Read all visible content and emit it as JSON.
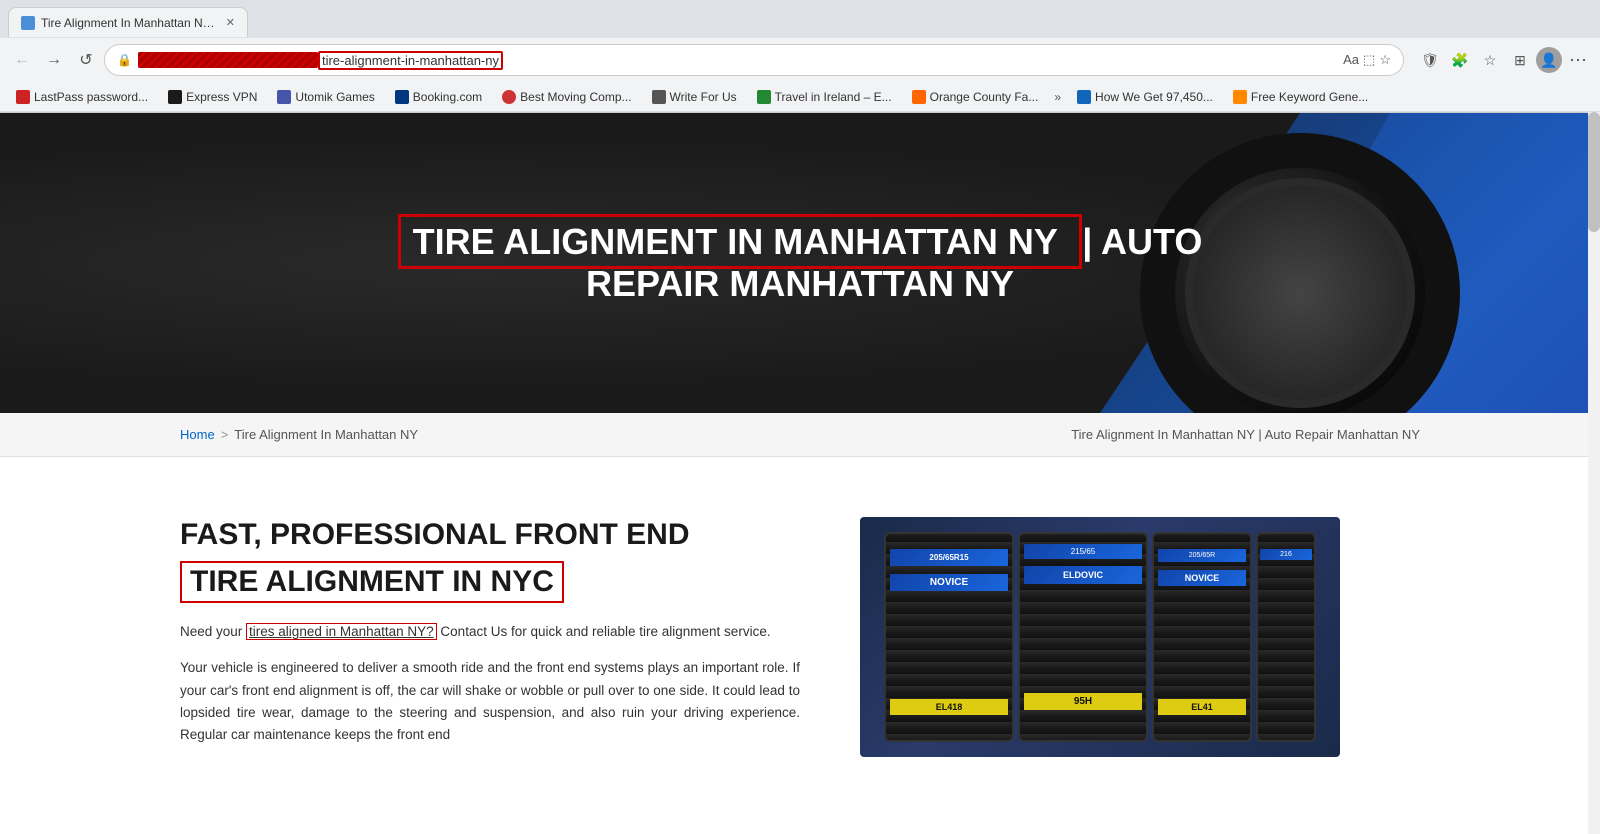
{
  "browser": {
    "tab": {
      "title": "Tire Alignment In Manhattan NY | Auto Repair Manhattan NY"
    },
    "address_bar": {
      "redacted_part": "https://[redacted]",
      "visible_part": "tire-alignment-in-manhattan-ny",
      "full_display": "tire-alignment-in-manhattan-ny"
    },
    "nav_buttons": {
      "back": "←",
      "forward": "→",
      "reload": "↺",
      "more": "⋯"
    }
  },
  "bookmarks": [
    {
      "id": "lastpass",
      "label": "LastPass password...",
      "favicon_class": "lastpass"
    },
    {
      "id": "expressvpn",
      "label": "Express VPN",
      "favicon_class": "express"
    },
    {
      "id": "utomik",
      "label": "Utomik Games",
      "favicon_class": "utomik"
    },
    {
      "id": "booking",
      "label": "Booking.com",
      "favicon_class": "booking"
    },
    {
      "id": "bestmoving",
      "label": "Best Moving Comp...",
      "favicon_class": "bestmoving"
    },
    {
      "id": "writeforus",
      "label": "Write For Us",
      "favicon_class": "writeforus"
    },
    {
      "id": "travel",
      "label": "Travel in Ireland – E...",
      "favicon_class": "travel"
    },
    {
      "id": "orange",
      "label": "Orange County Fa...",
      "favicon_class": "orange"
    },
    {
      "id": "howwe",
      "label": "How We Get 97,450...",
      "favicon_class": "howwe"
    },
    {
      "id": "freekw",
      "label": "Free Keyword Gene...",
      "favicon_class": "freekw"
    }
  ],
  "hero": {
    "title_part1": "TIRE ALIGNMENT IN MANHATTAN NY",
    "separator": " | ",
    "title_part2": "AUTO REPAIR MANHATTAN NY"
  },
  "breadcrumb": {
    "home": "Home",
    "separator": ">",
    "current": "Tire Alignment In Manhattan NY",
    "page_title": "Tire Alignment In Manhattan NY | Auto Repair Manhattan NY"
  },
  "main": {
    "heading_line1": "FAST, PROFESSIONAL FRONT END",
    "heading_line2": "TIRE ALIGNMENT IN NYC",
    "paragraph1_intro": "Need your ",
    "paragraph1_link": "tires aligned in Manhattan NY?",
    "paragraph1_rest": " Contact Us for quick and reliable tire alignment service.",
    "paragraph2": "Your vehicle is engineered to deliver a smooth ride and the front end systems plays an important role. If your car's front end alignment is off, the car will shake or wobble or pull over to one side. It could lead to lopsided tire wear, damage to the steering and suspension, and also ruin your driving experience. Regular car maintenance keeps the front end",
    "tire_image_alt": "Stacked tires with blue and yellow labels"
  },
  "tire_labels": [
    {
      "top": "205/65R15",
      "brand": "NOVICE",
      "bottom": "EL418"
    },
    {
      "top": "215/65",
      "brand": "ELDOVIC",
      "bottom": "95H"
    },
    {
      "top": "205/65R",
      "brand": "NOVICE",
      "bottom": "EL41"
    }
  ]
}
